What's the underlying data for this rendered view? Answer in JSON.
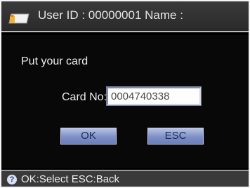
{
  "header": {
    "icon": "card-icon",
    "title": "User ID : 00000001  Name :"
  },
  "dialog": {
    "prompt": "Put your card",
    "card_no_label": "Card No:",
    "card_no_value": "0004740338"
  },
  "buttons": {
    "ok_label": "OK",
    "esc_label": "ESC"
  },
  "footer": {
    "icon": "help-icon",
    "hint": "OK:Select  ESC:Back"
  },
  "colors": {
    "background": "#000000",
    "button_fill": "#7f90c6",
    "text": "#ececec"
  }
}
